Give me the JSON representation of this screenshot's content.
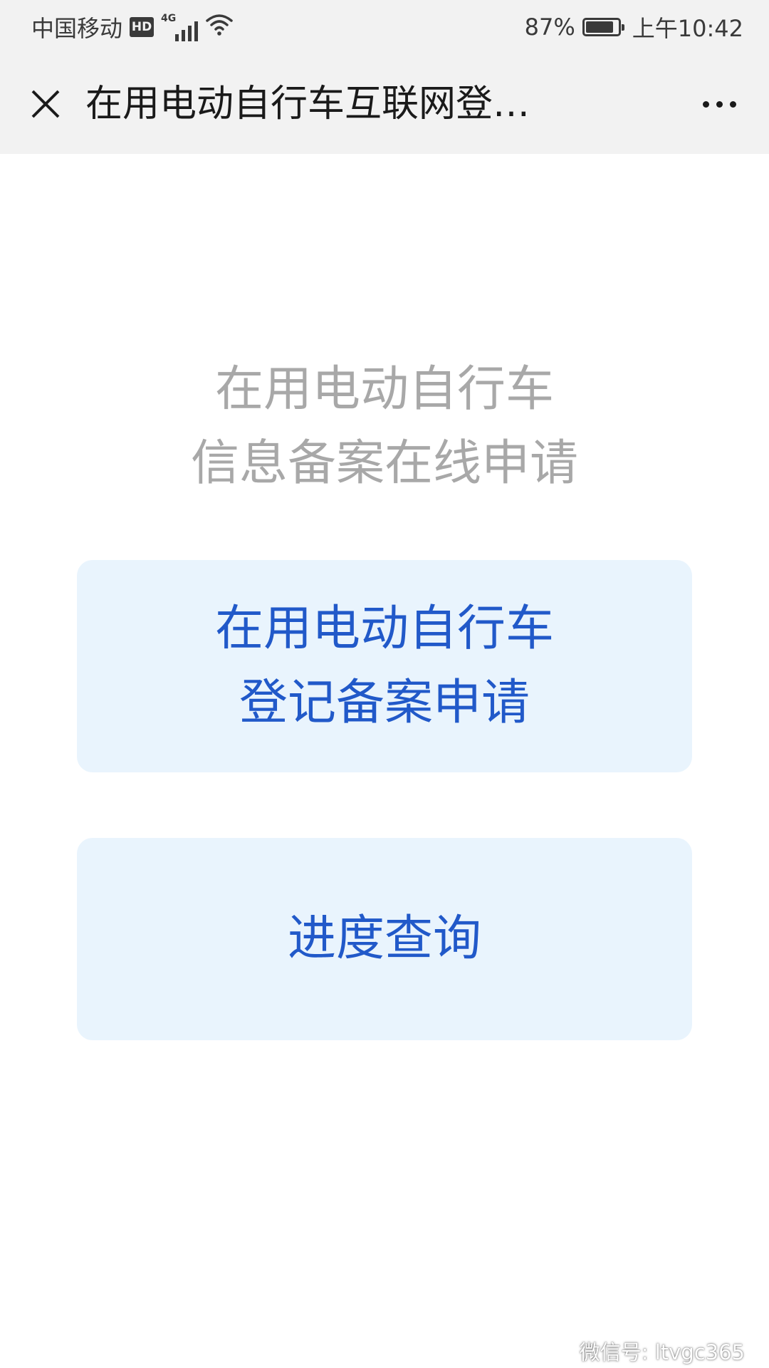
{
  "status_bar": {
    "carrier": "中国移动",
    "hd_badge": "HD",
    "network_type": "4G",
    "battery_percent": "87%",
    "battery_level": 0.87,
    "time": "上午10:42",
    "icons": [
      "hd-badge",
      "4g-signal-icon",
      "wifi-icon",
      "battery-icon"
    ]
  },
  "title_bar": {
    "close_icon": "close-icon",
    "title": "在用电动自行车互联网登…",
    "more_icon": "more-icon"
  },
  "heading": {
    "line1": "在用电动自行车",
    "line2": "信息备案在线申请"
  },
  "buttons": {
    "register": {
      "line1": "在用电动自行车",
      "line2": "登记备案申请"
    },
    "progress": {
      "label": "进度查询"
    }
  },
  "watermark": {
    "text": "微信号: ltvgc365",
    "icon": "wechat-icon"
  },
  "colors": {
    "status_background": "#f2f2f2",
    "heading_text": "#a8a8a8",
    "button_background": "#e9f4fd",
    "button_text": "#2159c9"
  }
}
